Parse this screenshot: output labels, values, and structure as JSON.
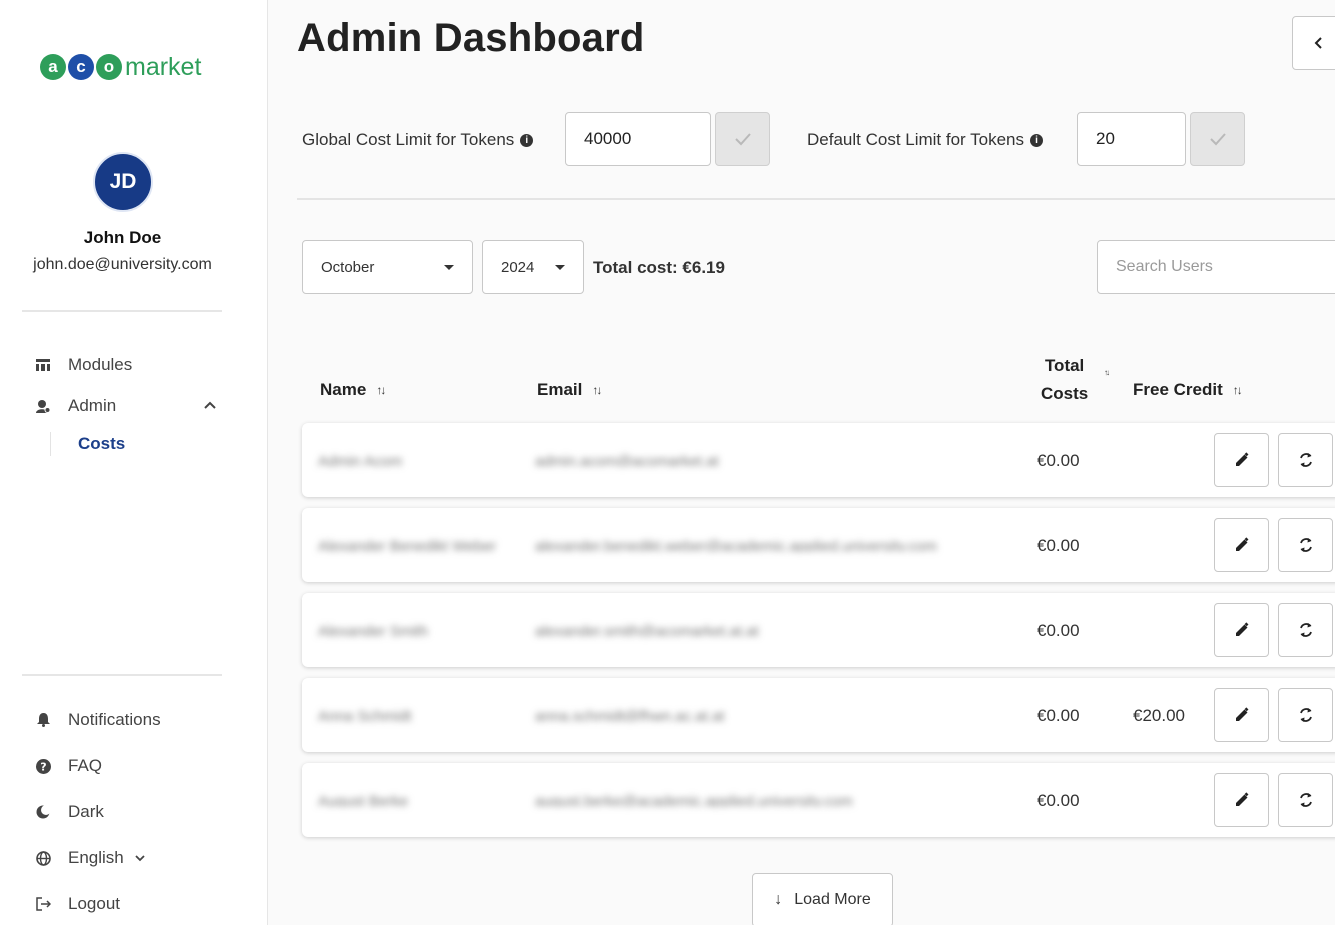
{
  "logo": {
    "letters": [
      "a",
      "c",
      "o"
    ],
    "text": "market",
    "colors": {
      "green": "#2e9e5a",
      "blue": "#1f4fa8"
    }
  },
  "user": {
    "initials": "JD",
    "name": "John Doe",
    "email": "john.doe@university.com"
  },
  "nav": {
    "modules": "Modules",
    "admin": "Admin",
    "costs": "Costs",
    "notifications": "Notifications",
    "faq": "FAQ",
    "dark": "Dark",
    "language": "English",
    "logout": "Logout"
  },
  "page": {
    "title": "Admin Dashboard"
  },
  "limits": {
    "global_label": "Global Cost Limit for Tokens",
    "global_value": "40000",
    "default_label": "Default Cost Limit for Tokens",
    "default_value": "20"
  },
  "filters": {
    "month": "October",
    "year": "2024",
    "total_cost": "Total cost: €6.19",
    "search_placeholder": "Search Users"
  },
  "table": {
    "headers": {
      "name": "Name",
      "email": "Email",
      "total_costs_line1": "Total",
      "total_costs_line2": "Costs",
      "free_credit": "Free Credit"
    },
    "rows": [
      {
        "name": "Admin Acom",
        "email": "admin.acom@acomarket.at",
        "total_cost": "€0.00",
        "free_credit": ""
      },
      {
        "name": "Alexander Benedikt Weber",
        "email": "alexander.benedikt.weber@academic.applied.university.com",
        "total_cost": "€0.00",
        "free_credit": ""
      },
      {
        "name": "Alexander Smith",
        "email": "alexander.smith@acomarket.at.at",
        "total_cost": "€0.00",
        "free_credit": ""
      },
      {
        "name": "Anna Schmidt",
        "email": "anna.schmidt@fhwn.ac.at.at",
        "total_cost": "€0.00",
        "free_credit": "€20.00"
      },
      {
        "name": "August Berke",
        "email": "august.berke@academic.applied.university.com",
        "total_cost": "€0.00",
        "free_credit": ""
      }
    ]
  },
  "load_more": "Load More"
}
